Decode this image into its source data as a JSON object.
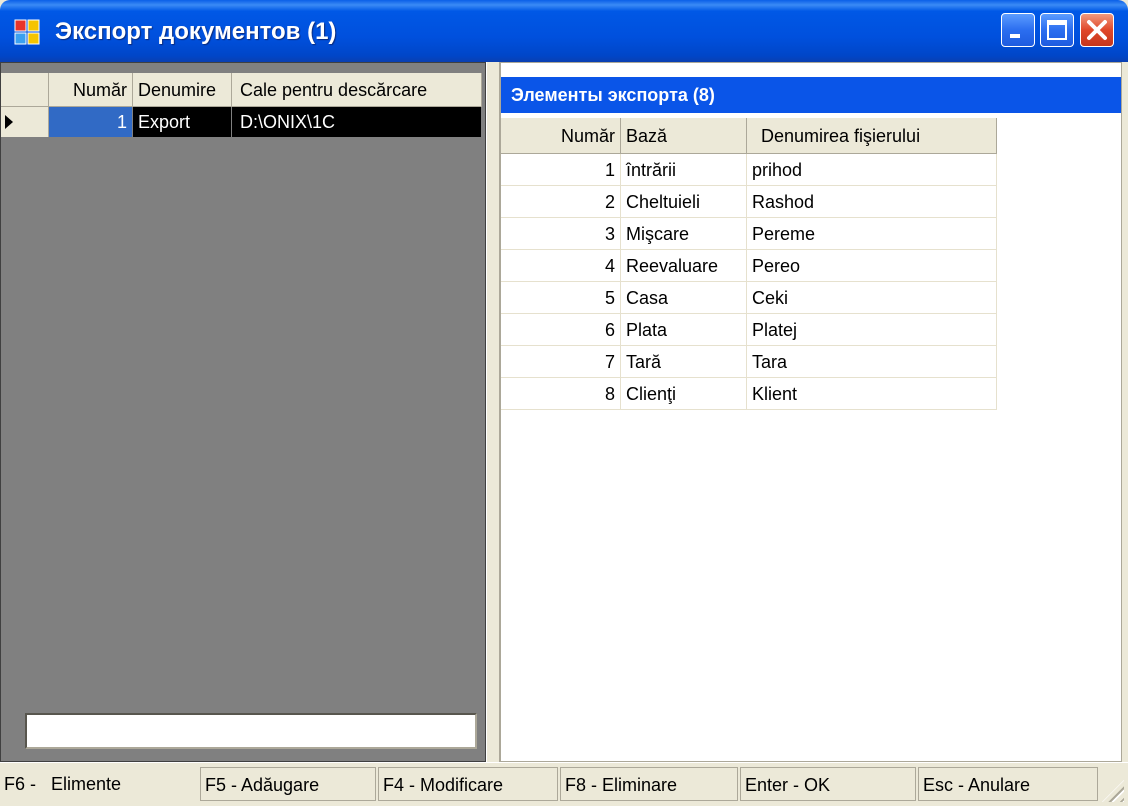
{
  "window": {
    "title": "Экспорт документов (1)",
    "accent_color": "#0A55E8",
    "buttons": {
      "minimize_icon": "minimize-icon",
      "maximize_icon": "maximize-icon",
      "close_icon": "close-icon"
    }
  },
  "left_grid": {
    "columns": [
      "Număr",
      "Denumire",
      "Cale pentru descărcare"
    ],
    "rows": [
      {
        "num": "1",
        "name": "Export",
        "path": "D:\\ONIX\\1C"
      }
    ],
    "filter_input": {
      "value": ""
    }
  },
  "right_panel": {
    "caption": "Элементы экспорта (8)",
    "columns": [
      "Număr",
      "Bază",
      "Denumirea fişierului"
    ],
    "rows": [
      {
        "num": "1",
        "base": "întrării",
        "file": "prihod"
      },
      {
        "num": "2",
        "base": "Cheltuieli",
        "file": "Rashod"
      },
      {
        "num": "3",
        "base": "Mişcare",
        "file": "Pereme"
      },
      {
        "num": "4",
        "base": "Reevaluare",
        "file": "Pereo"
      },
      {
        "num": "5",
        "base": "Casa",
        "file": "Ceki"
      },
      {
        "num": "6",
        "base": "Plata",
        "file": "Platej"
      },
      {
        "num": "7",
        "base": "Tară",
        "file": "Tara"
      },
      {
        "num": "8",
        "base": "Clienţi",
        "file": "Klient"
      }
    ]
  },
  "statusbar": {
    "f6_key": "F6 -",
    "f6_label": "Elimente",
    "f5": "F5 - Adăugare",
    "f4": "F4 - Modificare",
    "f8": "F8 - Eliminare",
    "enter": "Enter - OK",
    "esc": "Esc - Anulare"
  }
}
